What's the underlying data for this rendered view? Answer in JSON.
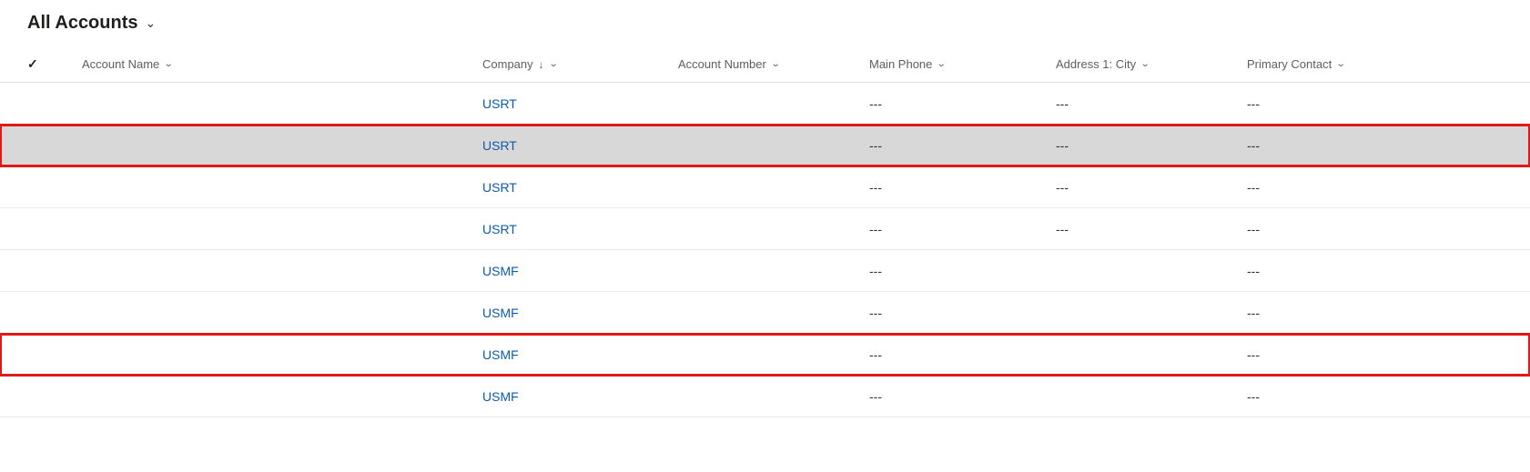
{
  "header": {
    "view_title": "All Accounts"
  },
  "columns": {
    "account_name": "Account Name",
    "company": "Company",
    "account_number": "Account Number",
    "main_phone": "Main Phone",
    "address_city": "Address 1: City",
    "primary_contact": "Primary Contact"
  },
  "rows": [
    {
      "account_name": "",
      "company": "USRT",
      "account_number": "",
      "main_phone": "---",
      "city": "---",
      "primary_contact": "---",
      "selected": false,
      "red_outline": false
    },
    {
      "account_name": "",
      "company": "USRT",
      "account_number": "",
      "main_phone": "---",
      "city": "---",
      "primary_contact": "---",
      "selected": true,
      "red_outline": true
    },
    {
      "account_name": "",
      "company": "USRT",
      "account_number": "",
      "main_phone": "---",
      "city": "---",
      "primary_contact": "---",
      "selected": false,
      "red_outline": false
    },
    {
      "account_name": "",
      "company": "USRT",
      "account_number": "",
      "main_phone": "---",
      "city": "---",
      "primary_contact": "---",
      "selected": false,
      "red_outline": false
    },
    {
      "account_name": "",
      "company": "USMF",
      "account_number": "",
      "main_phone": "---",
      "city": "",
      "primary_contact": "---",
      "selected": false,
      "red_outline": false
    },
    {
      "account_name": "",
      "company": "USMF",
      "account_number": "",
      "main_phone": "---",
      "city": "",
      "primary_contact": "---",
      "selected": false,
      "red_outline": false
    },
    {
      "account_name": "",
      "company": "USMF",
      "account_number": "",
      "main_phone": "---",
      "city": "",
      "primary_contact": "---",
      "selected": false,
      "red_outline": true
    },
    {
      "account_name": "",
      "company": "USMF",
      "account_number": "",
      "main_phone": "---",
      "city": "",
      "primary_contact": "---",
      "selected": false,
      "red_outline": false
    }
  ]
}
